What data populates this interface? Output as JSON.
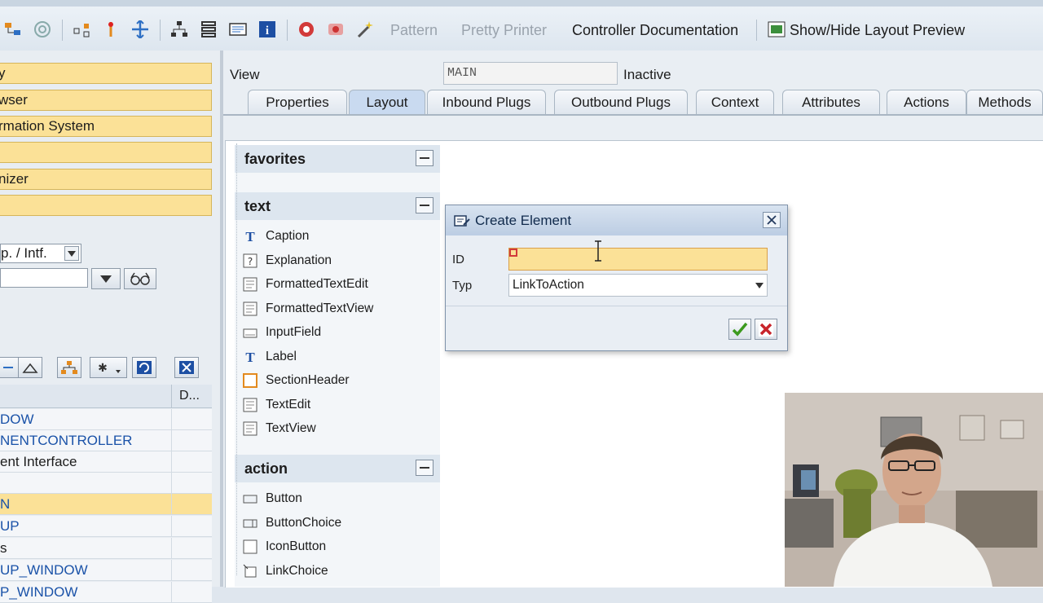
{
  "toolbar": {
    "pattern_label": "Pattern",
    "pretty_printer_label": "Pretty Printer",
    "controller_doc_label": "Controller Documentation",
    "layout_preview_label": "Show/Hide Layout Preview"
  },
  "left_panel": {
    "nav_buttons": [
      "y",
      "wser",
      "rmation System",
      "",
      "nizer",
      ""
    ],
    "object_type_select": "p. / Intf.",
    "tree_header_col2": "D...",
    "tree_rows": [
      {
        "text": "DOW",
        "style": "link"
      },
      {
        "text": "NENTCONTROLLER",
        "style": "link"
      },
      {
        "text": "ent Interface",
        "style": "plain"
      },
      {
        "text": "",
        "style": "plain"
      },
      {
        "text": "N",
        "style": "selected"
      },
      {
        "text": "UP",
        "style": "link"
      },
      {
        "text": "s",
        "style": "plain"
      },
      {
        "text": "UP_WINDOW",
        "style": "link"
      },
      {
        "text": "P_WINDOW",
        "style": "link"
      }
    ]
  },
  "view": {
    "label": "View",
    "name": "MAIN",
    "status": "Inactive"
  },
  "tabs": [
    "Properties",
    "Layout",
    "Inbound Plugs",
    "Outbound Plugs",
    "Context",
    "Attributes",
    "Actions",
    "Methods"
  ],
  "library": {
    "sections": [
      {
        "title": "favorites",
        "items": []
      },
      {
        "title": "text",
        "items": [
          "Caption",
          "Explanation",
          "FormattedTextEdit",
          "FormattedTextView",
          "InputField",
          "Label",
          "SectionHeader",
          "TextEdit",
          "TextView"
        ]
      },
      {
        "title": "action",
        "items": [
          "Button",
          "ButtonChoice",
          "IconButton",
          "LinkChoice"
        ]
      }
    ]
  },
  "dialog": {
    "title": "Create Element",
    "id_label": "ID",
    "id_value": "",
    "typ_label": "Typ",
    "typ_value": "LinkToAction"
  },
  "colors": {
    "nav_yellow": "#fbe197",
    "link_blue": "#1a52a8",
    "confirm_green": "#3c9a1e",
    "cancel_red": "#c8242b"
  }
}
